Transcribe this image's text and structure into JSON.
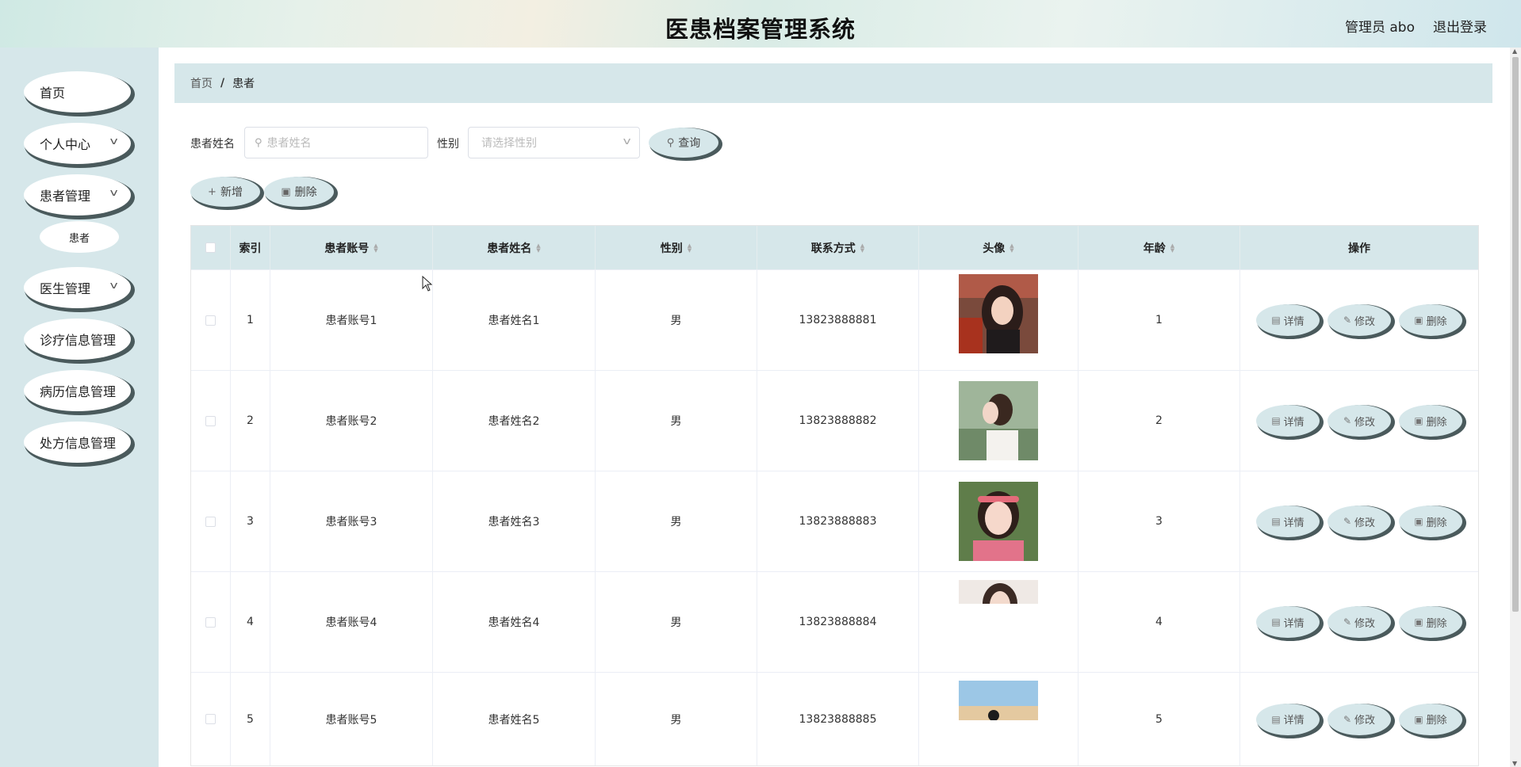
{
  "header": {
    "title": "医患档案管理系统",
    "user": "管理员 abo",
    "logout": "退出登录"
  },
  "sidebar": {
    "items": [
      {
        "label": "首页",
        "icon": ""
      },
      {
        "label": "个人中心",
        "icon": "chevron-down-icon"
      },
      {
        "label": "患者管理",
        "icon": "chevron-down-icon"
      },
      {
        "label": "医生管理",
        "icon": "chevron-down-icon"
      },
      {
        "label": "诊疗信息管理",
        "icon": ""
      },
      {
        "label": "病历信息管理",
        "icon": ""
      },
      {
        "label": "处方信息管理",
        "icon": ""
      }
    ],
    "submenu": {
      "label": "患者"
    }
  },
  "breadcrumb": {
    "home": "首页",
    "separator": "/",
    "current": "患者"
  },
  "search": {
    "name_label": "患者姓名",
    "name_placeholder": "患者姓名",
    "sex_label": "性别",
    "sex_placeholder": "请选择性别",
    "query_button": "查询"
  },
  "actions": {
    "add": "新增",
    "delete": "删除"
  },
  "table": {
    "headers": [
      "索引",
      "患者账号",
      "患者姓名",
      "性别",
      "联系方式",
      "头像",
      "年龄",
      "操作"
    ],
    "rows": [
      {
        "index": "1",
        "account": "患者账号1",
        "name": "患者姓名1",
        "sex": "男",
        "phone": "13823888881",
        "age": "1"
      },
      {
        "index": "2",
        "account": "患者账号2",
        "name": "患者姓名2",
        "sex": "男",
        "phone": "13823888882",
        "age": "2"
      },
      {
        "index": "3",
        "account": "患者账号3",
        "name": "患者姓名3",
        "sex": "男",
        "phone": "13823888883",
        "age": "3"
      },
      {
        "index": "4",
        "account": "患者账号4",
        "name": "患者姓名4",
        "sex": "男",
        "phone": "13823888884",
        "age": "4"
      },
      {
        "index": "5",
        "account": "患者账号5",
        "name": "患者姓名5",
        "sex": "男",
        "phone": "13823888885",
        "age": "5"
      }
    ],
    "ops": {
      "detail": "详情",
      "edit": "修改",
      "delete": "删除"
    }
  },
  "colors": {
    "accent": "#d6e7ea",
    "shadow": "#4a5a5c"
  }
}
